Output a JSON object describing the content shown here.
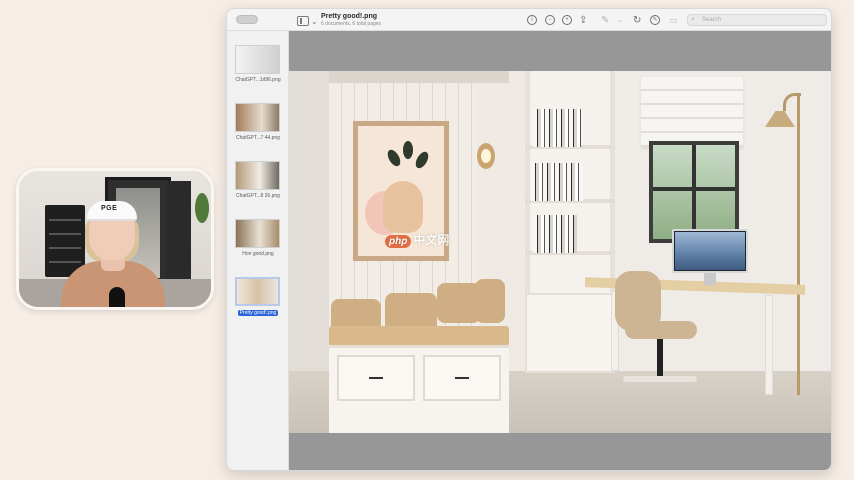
{
  "window": {
    "title": "Pretty good!.png",
    "subtitle": "6 documents, 6 total pages"
  },
  "toolbar": {
    "info_icon": "info-icon",
    "zoom_out_icon": "zoom-out-icon",
    "zoom_in_icon": "zoom-in-icon",
    "share_icon": "share-icon",
    "markup_icon": "markup-pen-icon",
    "rotate_icon": "rotate-icon",
    "annotate_icon": "annotate-icon",
    "search_placeholder": "Search"
  },
  "thumbnails": [
    {
      "label": "ChatGPT...1d96.png",
      "selected": false
    },
    {
      "label": "ChatGPT...7 44.png",
      "selected": false
    },
    {
      "label": "ChatGPT...8 26.png",
      "selected": false
    },
    {
      "label": "Hon good.png",
      "selected": false
    },
    {
      "label": "Pretty good!.png",
      "selected": true
    }
  ],
  "watermark": {
    "badge": "php",
    "text": "中文网"
  },
  "webcam": {
    "cap_text": "PGE"
  },
  "colors": {
    "selection": "#2863d8",
    "viewer_bg": "#979797",
    "page_bg": "#f6ede6"
  }
}
